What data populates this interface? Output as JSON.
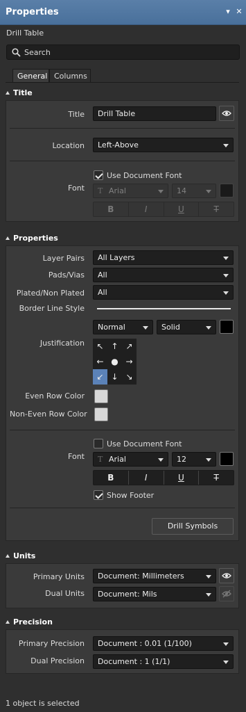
{
  "panel": {
    "title": "Properties",
    "menu_icon": "▾",
    "close_icon": "✕"
  },
  "object_type": "Drill Table",
  "search": {
    "placeholder": "Search"
  },
  "tabs": [
    "General",
    "Columns"
  ],
  "title_section": {
    "header": "Title",
    "title_label": "Title",
    "title_value": "Drill Table",
    "location_label": "Location",
    "location_value": "Left-Above",
    "font_label": "Font",
    "use_doc_font": "Use Document Font",
    "font_name": "Arial",
    "font_size": "14",
    "font_color": "#1a1a1a",
    "fmt": [
      "B",
      "I",
      "U",
      "T"
    ]
  },
  "properties_section": {
    "header": "Properties",
    "layer_pairs_label": "Layer Pairs",
    "layer_pairs_value": "All Layers",
    "pads_vias_label": "Pads/Vias",
    "pads_vias_value": "All",
    "plated_label": "Plated/Non Plated",
    "plated_value": "All",
    "border_style_label": "Border Line Style",
    "line_width": "Normal",
    "line_style": "Solid",
    "border_color": "#000000",
    "justification_label": "Justification",
    "justification_arrows": [
      "↖",
      "↑",
      "↗",
      "←",
      "●",
      "→",
      "↙",
      "↓",
      "↘"
    ],
    "justification_selected": "bottom-left",
    "even_row_label": "Even Row Color",
    "even_row_color": "#d8d8d8",
    "noneven_row_label": "Non-Even Row Color",
    "noneven_row_color": "#d8d8d8",
    "font_label": "Font",
    "use_doc_font": "Use Document Font",
    "font_name": "Arial",
    "font_size": "12",
    "font_color": "#000000",
    "fmt": [
      "B",
      "I",
      "U",
      "T"
    ],
    "show_footer": "Show Footer",
    "drill_symbols": "Drill Symbols"
  },
  "units_section": {
    "header": "Units",
    "primary_label": "Primary Units",
    "primary_value": "Document: Millimeters",
    "dual_label": "Dual Units",
    "dual_value": "Document: Mils"
  },
  "precision_section": {
    "header": "Precision",
    "primary_label": "Primary Precision",
    "primary_value": "Document : 0.01 (1/100)",
    "dual_label": "Dual Precision",
    "dual_value": "Document : 1 (1/1)"
  },
  "status": "1 object is selected"
}
